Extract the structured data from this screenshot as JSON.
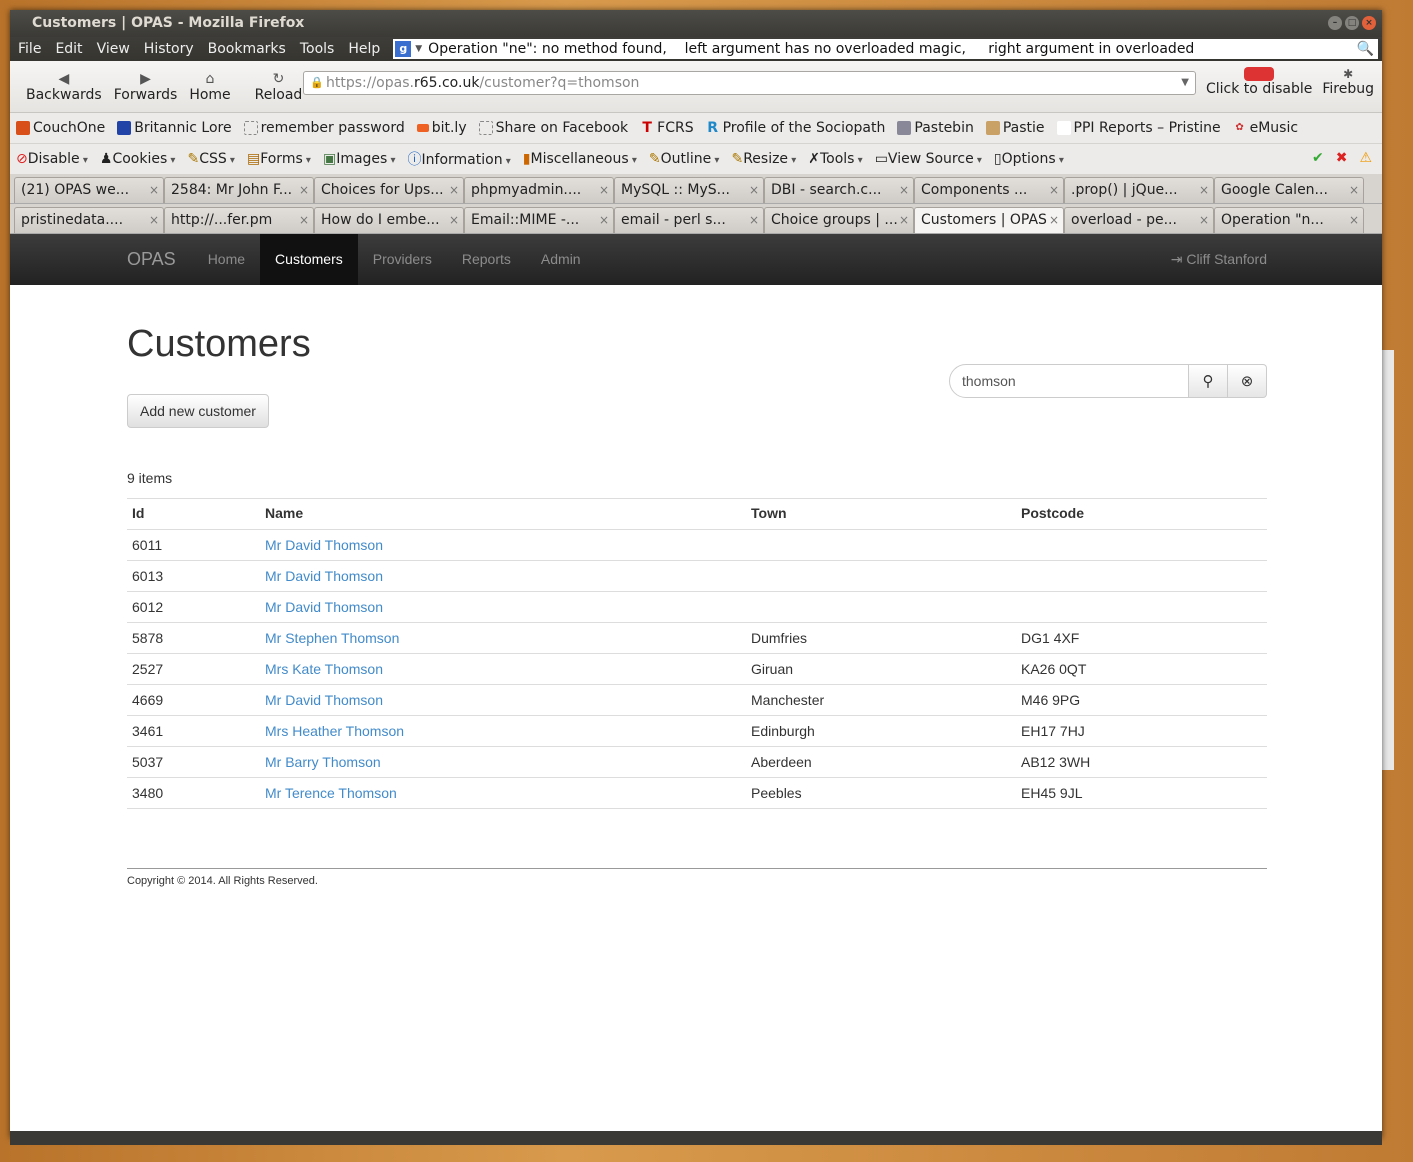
{
  "window": {
    "title": "Customers | OPAS - Mozilla Firefox"
  },
  "menu": [
    "File",
    "Edit",
    "View",
    "History",
    "Bookmarks",
    "Tools",
    "Help"
  ],
  "message_field": "Operation \"ne\": no method found,    left argument has no overloaded magic,     right argument in overloaded",
  "nav": {
    "back": "Backwards",
    "forward": "Forwards",
    "home": "Home",
    "reload": "Reload",
    "url_prefix": "https://opas.",
    "url_domain": "r65.co.uk",
    "url_path": "/customer?q=thomson",
    "click_disable": "Click to disable",
    "firebug": "Firebug"
  },
  "bookmarks": [
    "CouchOne",
    "Britannic Lore",
    "remember password",
    "bit.ly",
    "Share on Facebook",
    "FCRS",
    "Profile of the Sociopath",
    "Pastebin",
    "Pastie",
    "PPI Reports – Pristine",
    "eMusic"
  ],
  "devtools": [
    "Disable",
    "Cookies",
    "CSS",
    "Forms",
    "Images",
    "Information",
    "Miscellaneous",
    "Outline",
    "Resize",
    "Tools",
    "View Source",
    "Options"
  ],
  "tabs_row1": [
    "(21) OPAS we...",
    "2584: Mr John F...",
    "Choices for Ups...",
    "phpmyadmin....",
    "MySQL :: MyS...",
    "DBI - search.c...",
    "Components ...",
    ".prop() | jQue...",
    "Google Calen..."
  ],
  "tabs_row2": [
    "pristinedata....",
    "http://...fer.pm",
    "How do I embe...",
    "Email::MIME -...",
    "email - perl s...",
    "Choice groups | ...",
    "Customers | OPAS",
    "overload - pe...",
    "Operation \"n..."
  ],
  "app": {
    "brand": "OPAS",
    "links": [
      "Home",
      "Customers",
      "Providers",
      "Reports",
      "Admin"
    ],
    "user": "Cliff Stanford"
  },
  "page": {
    "heading": "Customers",
    "add_button": "Add new customer",
    "search_value": "thomson",
    "count": "9 items",
    "columns": [
      "Id",
      "Name",
      "Town",
      "Postcode"
    ],
    "rows": [
      [
        "6011",
        "Mr David Thomson",
        "",
        ""
      ],
      [
        "6013",
        "Mr David Thomson",
        "",
        ""
      ],
      [
        "6012",
        "Mr David Thomson",
        "",
        ""
      ],
      [
        "5878",
        "Mr Stephen Thomson",
        "Dumfries",
        "DG1 4XF"
      ],
      [
        "2527",
        "Mrs Kate Thomson",
        "Giruan",
        "KA26 0QT"
      ],
      [
        "4669",
        "Mr David Thomson",
        "Manchester",
        "M46 9PG"
      ],
      [
        "3461",
        "Mrs Heather Thomson",
        "Edinburgh",
        "EH17 7HJ"
      ],
      [
        "5037",
        "Mr Barry Thomson",
        "Aberdeen",
        "AB12 3WH"
      ],
      [
        "3480",
        "Mr Terence Thomson",
        "Peebles",
        "EH45 9JL"
      ]
    ],
    "footer": "Copyright © 2014. All Rights Reserved."
  }
}
